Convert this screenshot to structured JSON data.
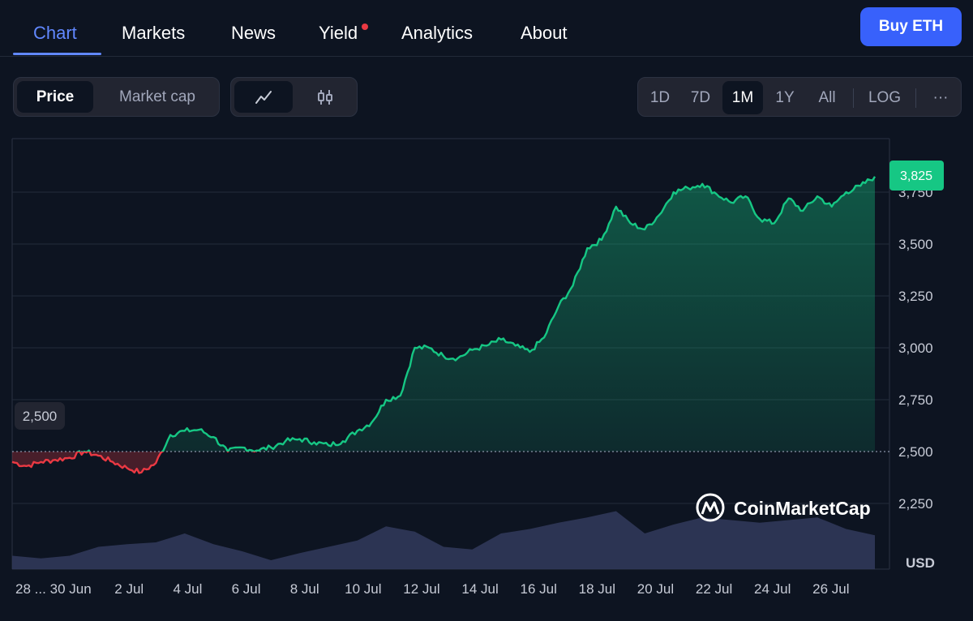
{
  "nav": {
    "tabs": [
      {
        "label": "Chart",
        "active": true
      },
      {
        "label": "Markets"
      },
      {
        "label": "News"
      },
      {
        "label": "Yield",
        "has_dot": true
      },
      {
        "label": "Analytics"
      },
      {
        "label": "About"
      }
    ],
    "buy_label": "Buy ETH"
  },
  "toggle": {
    "price": "Price",
    "market_cap": "Market cap",
    "selected": "Price"
  },
  "chart_type": {
    "line_icon": "line-chart-icon",
    "candle_icon": "candlestick-icon",
    "selected": "line"
  },
  "ranges": {
    "items": [
      "1D",
      "7D",
      "1M",
      "1Y",
      "All"
    ],
    "selected": "1M",
    "log": "LOG",
    "more": "···"
  },
  "watermark": "CoinMarketCap",
  "colors": {
    "up": "#16c784",
    "down": "#ea3943",
    "accent": "#3861fb",
    "volume": "#323a5c",
    "bg": "#0d1421"
  },
  "chart_data": {
    "type": "area",
    "ylabel": "USD",
    "ylim": [
      2100,
      3950
    ],
    "yticks": [
      "2,250",
      "2,500",
      "2,750",
      "3,000",
      "3,250",
      "3,500",
      "3,750"
    ],
    "ytick_values": [
      2250,
      2500,
      2750,
      3000,
      3250,
      3500,
      3750
    ],
    "xtick_labels": [
      "28 ...",
      "30 Jun",
      "2 Jul",
      "4 Jul",
      "6 Jul",
      "8 Jul",
      "10 Jul",
      "12 Jul",
      "14 Jul",
      "16 Jul",
      "18 Jul",
      "20 Jul",
      "22 Jul",
      "24 Jul",
      "26 Jul"
    ],
    "xtick_days": [
      0,
      2,
      4,
      6,
      8,
      10,
      12,
      14,
      16,
      18,
      20,
      22,
      24,
      26,
      28
    ],
    "reference": {
      "label": "2,500",
      "value": 2500
    },
    "current": {
      "label": "3,825",
      "value": 3825
    },
    "grid": true,
    "series": [
      {
        "name": "Price",
        "x": [
          "28 Jun",
          "28 Jun 12:00",
          "29 Jun",
          "29 Jun 12:00",
          "30 Jun",
          "30 Jun 12:00",
          "1 Jul",
          "1 Jul 12:00",
          "2 Jul",
          "2 Jul 12:00",
          "3 Jul",
          "3 Jul 12:00",
          "4 Jul",
          "4 Jul 12:00",
          "5 Jul",
          "5 Jul 12:00",
          "6 Jul",
          "6 Jul 12:00",
          "7 Jul",
          "7 Jul 12:00",
          "8 Jul",
          "8 Jul 12:00",
          "9 Jul",
          "9 Jul 12:00",
          "10 Jul",
          "10 Jul 12:00",
          "11 Jul",
          "11 Jul 12:00",
          "12 Jul",
          "12 Jul 12:00",
          "13 Jul",
          "13 Jul 12:00",
          "14 Jul",
          "14 Jul 12:00",
          "15 Jul",
          "15 Jul 12:00",
          "16 Jul",
          "16 Jul 12:00",
          "17 Jul",
          "17 Jul 12:00",
          "18 Jul",
          "18 Jul 12:00",
          "19 Jul",
          "19 Jul 12:00",
          "20 Jul",
          "20 Jul 12:00",
          "21 Jul",
          "21 Jul 12:00",
          "22 Jul",
          "22 Jul 12:00",
          "23 Jul",
          "23 Jul 12:00",
          "24 Jul",
          "24 Jul 12:00",
          "25 Jul",
          "25 Jul 12:00",
          "26 Jul",
          "26 Jul 12:00",
          "27 Jul",
          "27 Jul 12:00",
          "28 Jul"
        ],
        "values": [
          2450,
          2430,
          2450,
          2460,
          2470,
          2500,
          2480,
          2450,
          2420,
          2400,
          2445,
          2580,
          2600,
          2605,
          2570,
          2500,
          2520,
          2505,
          2520,
          2550,
          2560,
          2545,
          2530,
          2550,
          2600,
          2640,
          2750,
          2770,
          3000,
          3000,
          2960,
          2950,
          2990,
          3010,
          3040,
          3010,
          2980,
          3050,
          3200,
          3300,
          3480,
          3520,
          3680,
          3600,
          3570,
          3640,
          3750,
          3770,
          3790,
          3740,
          3700,
          3730,
          3620,
          3600,
          3720,
          3660,
          3730,
          3680,
          3750,
          3780,
          3825
        ]
      }
    ],
    "volume": {
      "x_days": [
        0,
        1,
        2,
        3,
        4,
        5,
        6,
        7,
        8,
        9,
        10,
        11,
        12,
        13,
        14,
        15,
        16,
        17,
        18,
        19,
        20,
        21,
        22,
        23,
        24,
        25,
        26,
        27,
        28,
        29,
        30
      ],
      "relative": [
        0.15,
        0.12,
        0.15,
        0.25,
        0.28,
        0.3,
        0.4,
        0.28,
        0.2,
        0.1,
        0.18,
        0.25,
        0.32,
        0.48,
        0.42,
        0.25,
        0.22,
        0.4,
        0.45,
        0.52,
        0.58,
        0.65,
        0.4,
        0.5,
        0.58,
        0.55,
        0.52,
        0.55,
        0.58,
        0.45,
        0.38
      ]
    }
  }
}
